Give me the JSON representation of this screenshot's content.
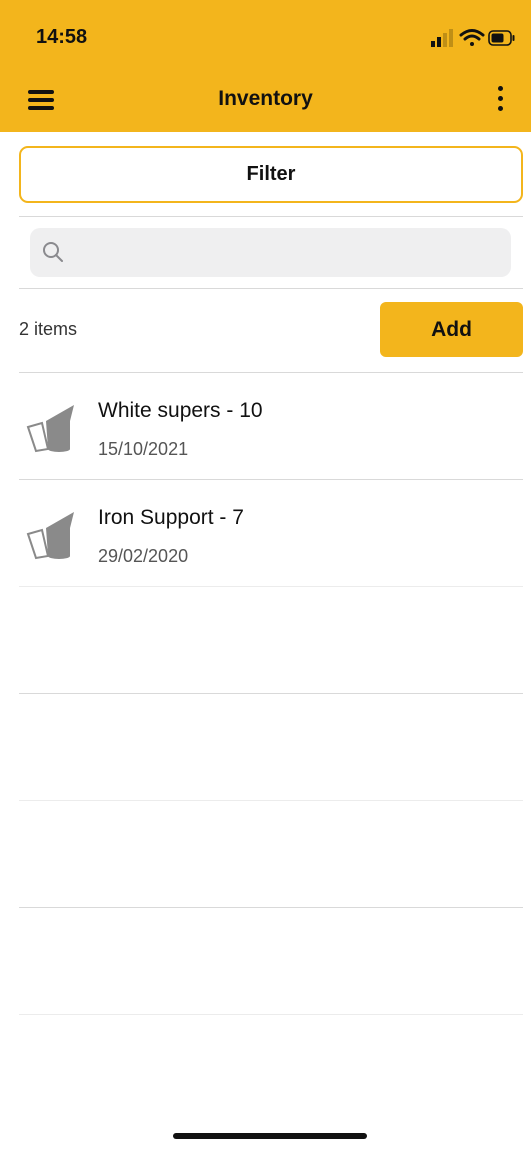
{
  "status_bar": {
    "time": "14:58"
  },
  "header": {
    "title": "Inventory",
    "menu_icon": "hamburger-icon",
    "more_icon": "more-vertical-icon"
  },
  "filter": {
    "label": "Filter"
  },
  "search": {
    "placeholder": "",
    "value": "",
    "icon": "search-icon"
  },
  "list": {
    "count_label": "2 items",
    "add_label": "Add",
    "items": [
      {
        "name": "White supers - 10",
        "date": "15/10/2021",
        "icon": "smoker-icon"
      },
      {
        "name": "Iron Support - 7",
        "date": "29/02/2020",
        "icon": "smoker-icon"
      }
    ]
  },
  "colors": {
    "accent": "#f3b51c",
    "divider": "#d9d9d9",
    "search_bg": "#efeff0",
    "icon_gray": "#8a8a8a"
  }
}
